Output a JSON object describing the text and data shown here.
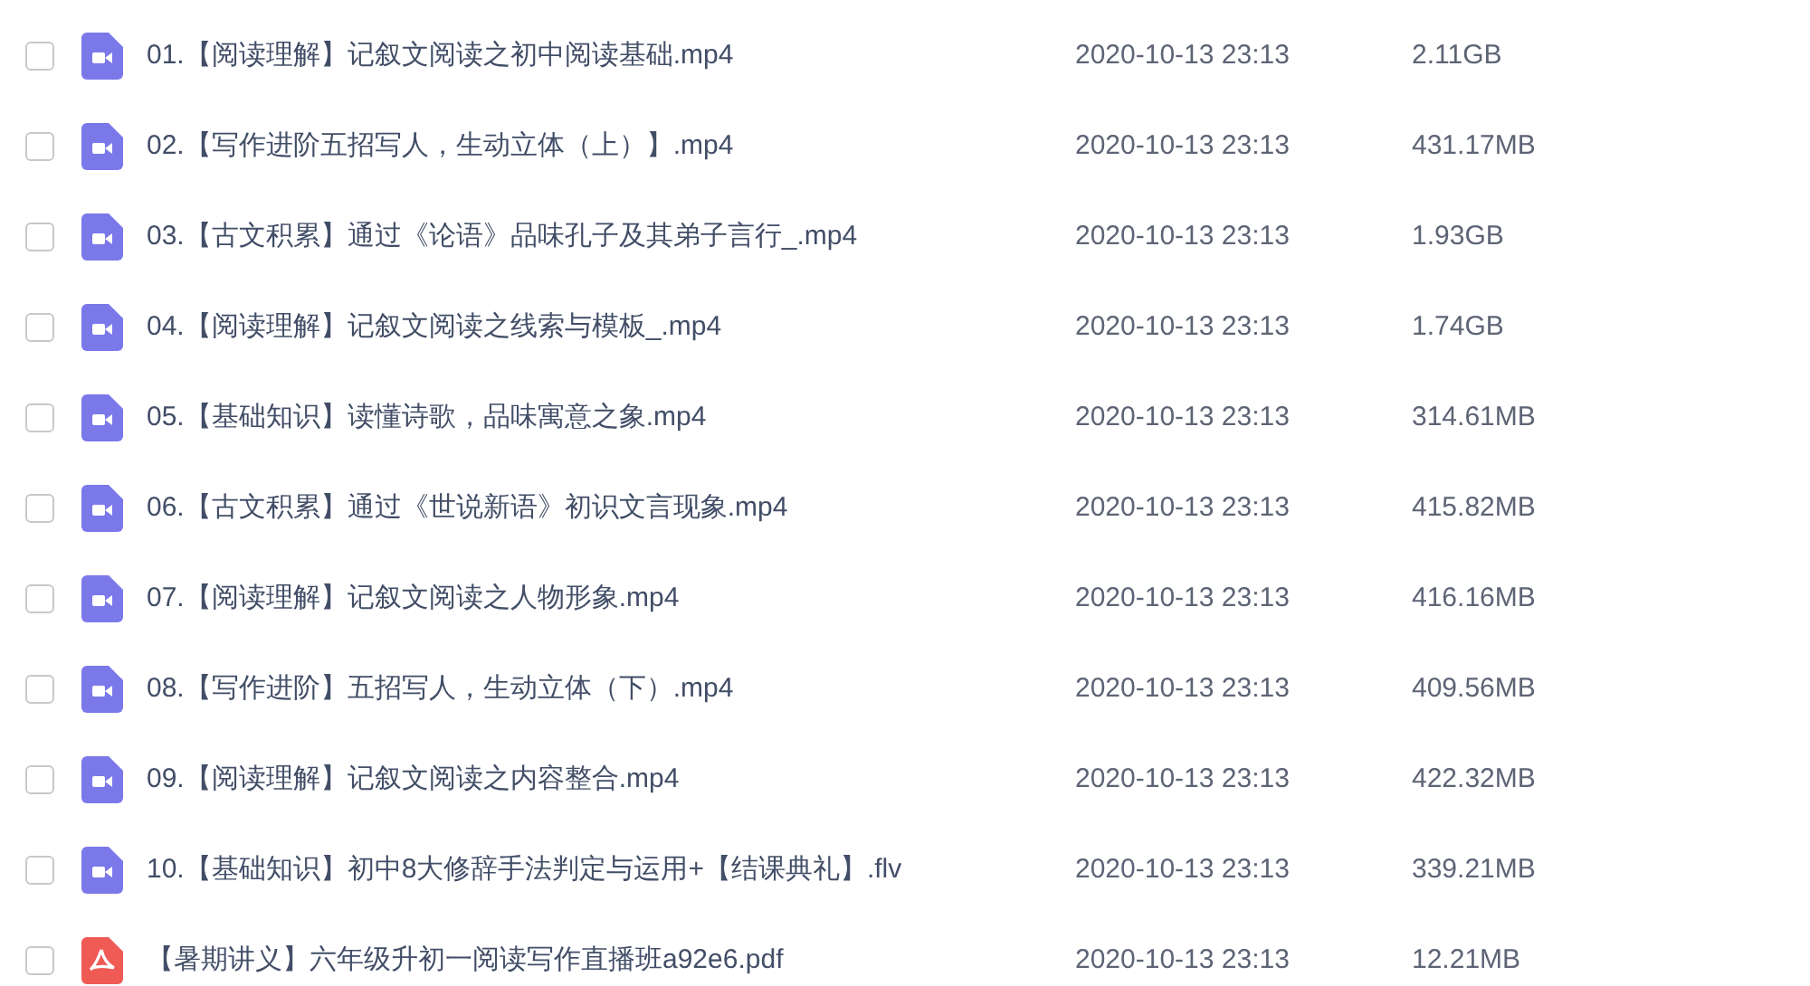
{
  "files": [
    {
      "kind": "video",
      "checked": false,
      "name": "01.【阅读理解】记叙文阅读之初中阅读基础.mp4",
      "modified": "2020-10-13 23:13",
      "size": "2.11GB"
    },
    {
      "kind": "video",
      "checked": false,
      "name": "02.【写作进阶五招写人，生动立体（上）】.mp4",
      "modified": "2020-10-13 23:13",
      "size": "431.17MB"
    },
    {
      "kind": "video",
      "checked": false,
      "name": "03.【古文积累】通过《论语》品味孔子及其弟子言行_.mp4",
      "modified": "2020-10-13 23:13",
      "size": "1.93GB"
    },
    {
      "kind": "video",
      "checked": false,
      "name": "04.【阅读理解】记叙文阅读之线索与模板_.mp4",
      "modified": "2020-10-13 23:13",
      "size": "1.74GB"
    },
    {
      "kind": "video",
      "checked": false,
      "name": "05.【基础知识】读懂诗歌，品味寓意之象.mp4",
      "modified": "2020-10-13 23:13",
      "size": "314.61MB"
    },
    {
      "kind": "video",
      "checked": false,
      "name": "06.【古文积累】通过《世说新语》初识文言现象.mp4",
      "modified": "2020-10-13 23:13",
      "size": "415.82MB"
    },
    {
      "kind": "video",
      "checked": false,
      "name": "07.【阅读理解】记叙文阅读之人物形象.mp4",
      "modified": "2020-10-13 23:13",
      "size": "416.16MB"
    },
    {
      "kind": "video",
      "checked": false,
      "name": "08.【写作进阶】五招写人，生动立体（下）.mp4",
      "modified": "2020-10-13 23:13",
      "size": "409.56MB"
    },
    {
      "kind": "video",
      "checked": false,
      "name": "09.【阅读理解】记叙文阅读之内容整合.mp4",
      "modified": "2020-10-13 23:13",
      "size": "422.32MB"
    },
    {
      "kind": "video",
      "checked": false,
      "name": "10.【基础知识】初中8大修辞手法判定与运用+【结课典礼】.flv",
      "modified": "2020-10-13 23:13",
      "size": "339.21MB"
    },
    {
      "kind": "pdf",
      "checked": false,
      "name": "【暑期讲义】六年级升初一阅读写作直播班a92e6.pdf",
      "modified": "2020-10-13 23:13",
      "size": "12.21MB"
    }
  ]
}
